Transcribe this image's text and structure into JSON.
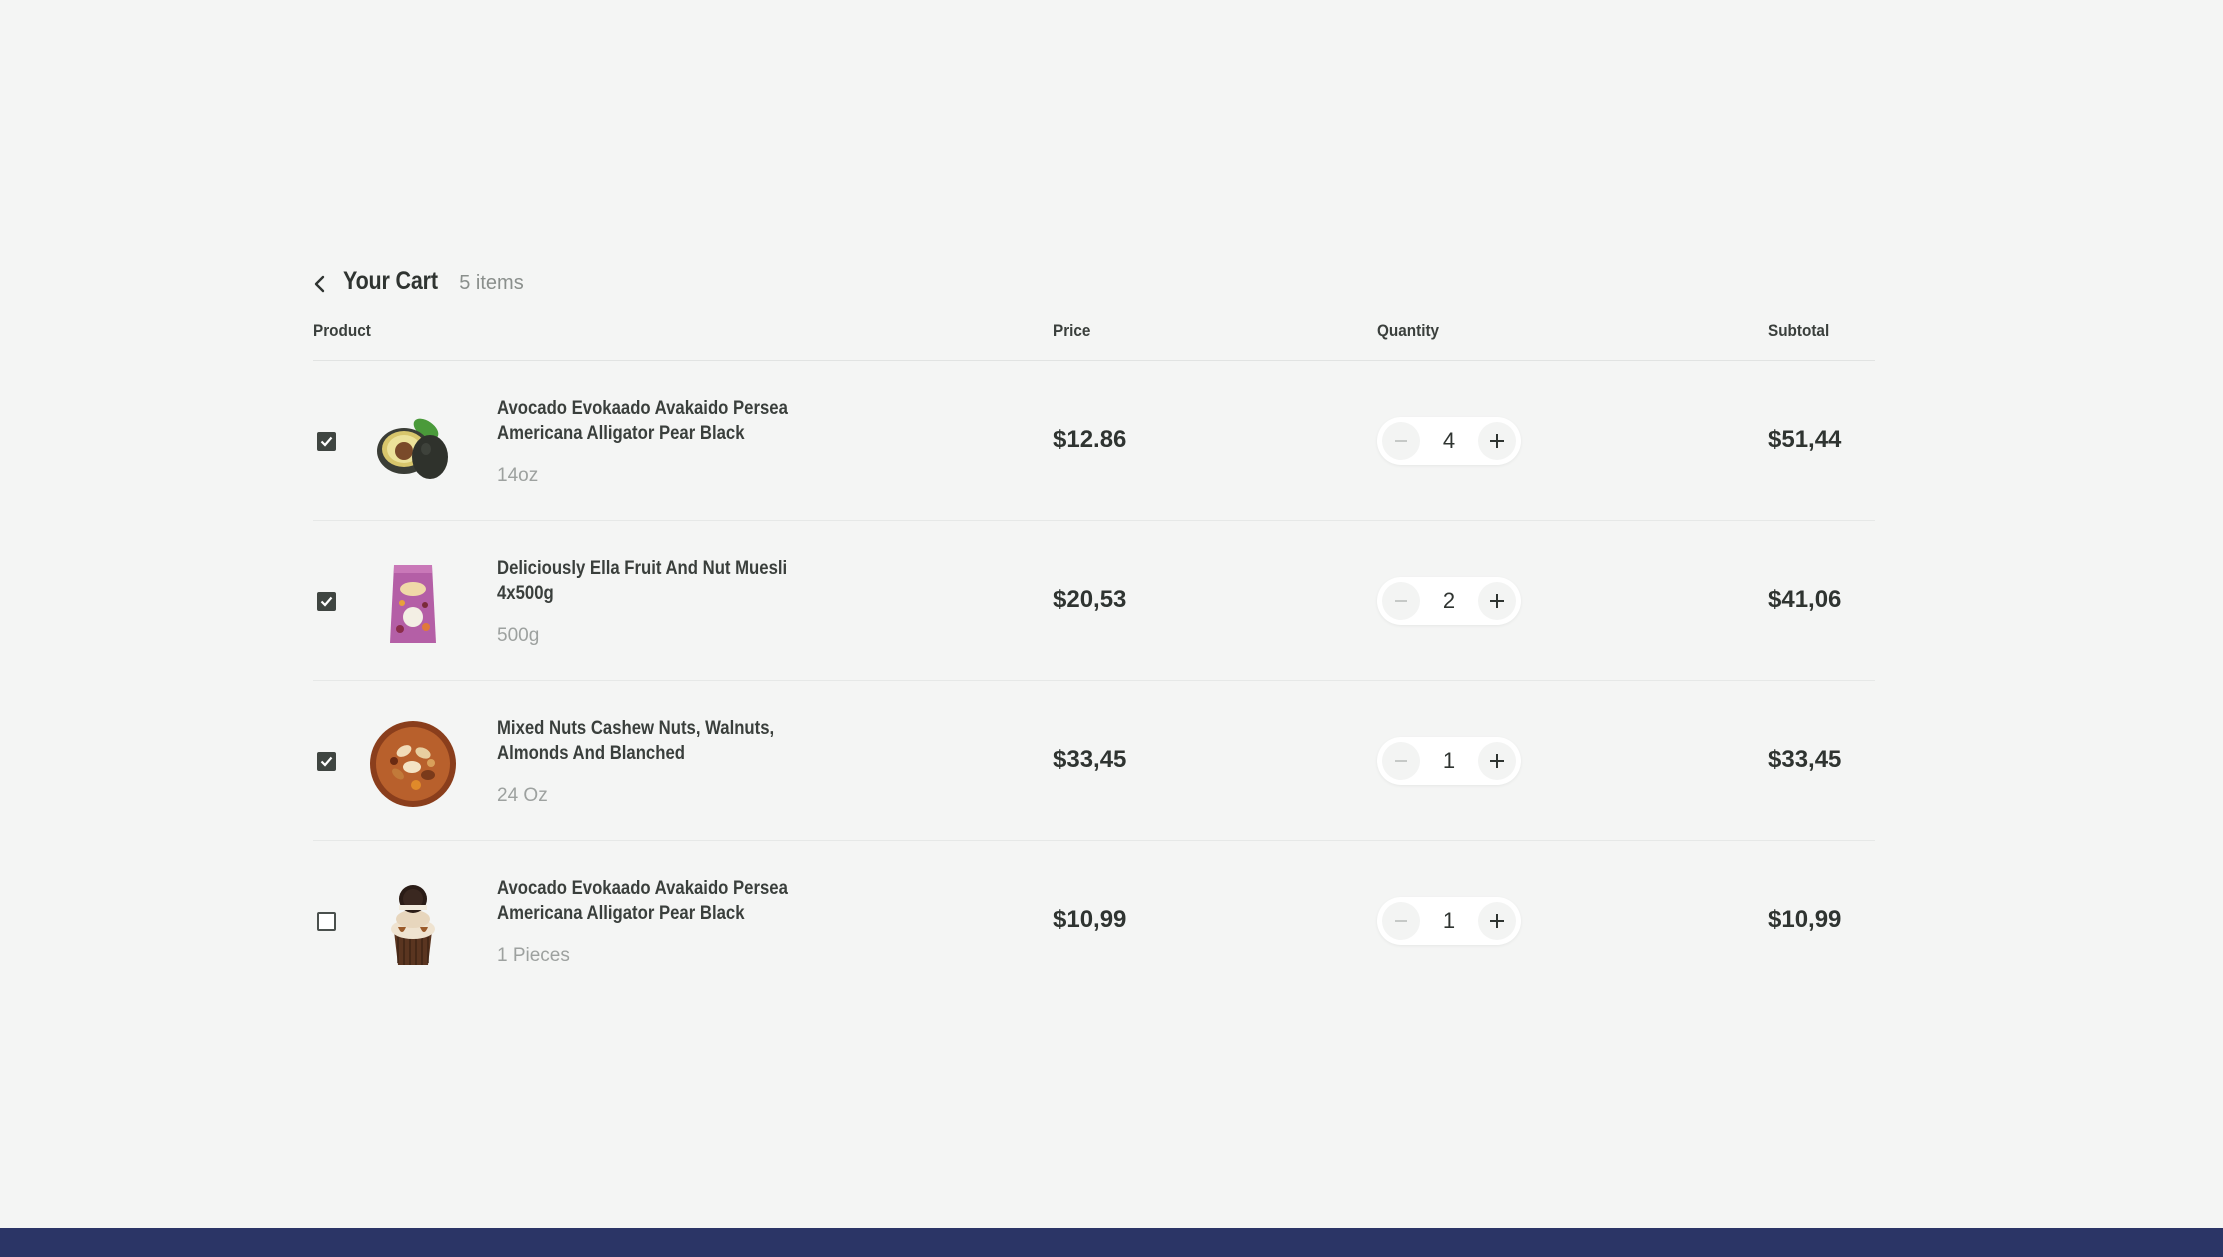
{
  "cart": {
    "title": "Your Cart",
    "count_label": "5 items",
    "back_icon": "chevron-left-icon"
  },
  "columns": {
    "product": "Product",
    "price": "Price",
    "quantity": "Quantity",
    "subtotal": "Subtotal"
  },
  "items": [
    {
      "name": "Avocado Evokaado Avakaido Persea Americana Alligator Pear Black",
      "variant": "14oz",
      "price": "$12.86",
      "quantity": "4",
      "subtotal": "$51,44",
      "checked": true,
      "image": "avocado-image"
    },
    {
      "name": "Deliciously Ella Fruit And Nut Muesli 4x500g",
      "variant": "500g",
      "price": "$20,53",
      "quantity": "2",
      "subtotal": "$41,06",
      "checked": true,
      "image": "muesli-bag-image"
    },
    {
      "name": "Mixed Nuts Cashew Nuts, Walnuts, Almonds And Blanched",
      "variant": "24 Oz",
      "price": "$33,45",
      "quantity": "1",
      "subtotal": "$33,45",
      "checked": true,
      "image": "mixed-nuts-bowl-image"
    },
    {
      "name": "Avocado Evokaado Avakaido Persea Americana Alligator Pear Black",
      "variant": "1 Pieces",
      "price": "$10,99",
      "quantity": "1",
      "subtotal": "$10,99",
      "checked": false,
      "image": "cookie-cupcake-image"
    }
  ],
  "colors": {
    "background": "#f4f5f4",
    "text": "#3a3f3c",
    "muted": "#9da19f",
    "footer": "#2b3566",
    "checkbox": "#3f4541"
  }
}
